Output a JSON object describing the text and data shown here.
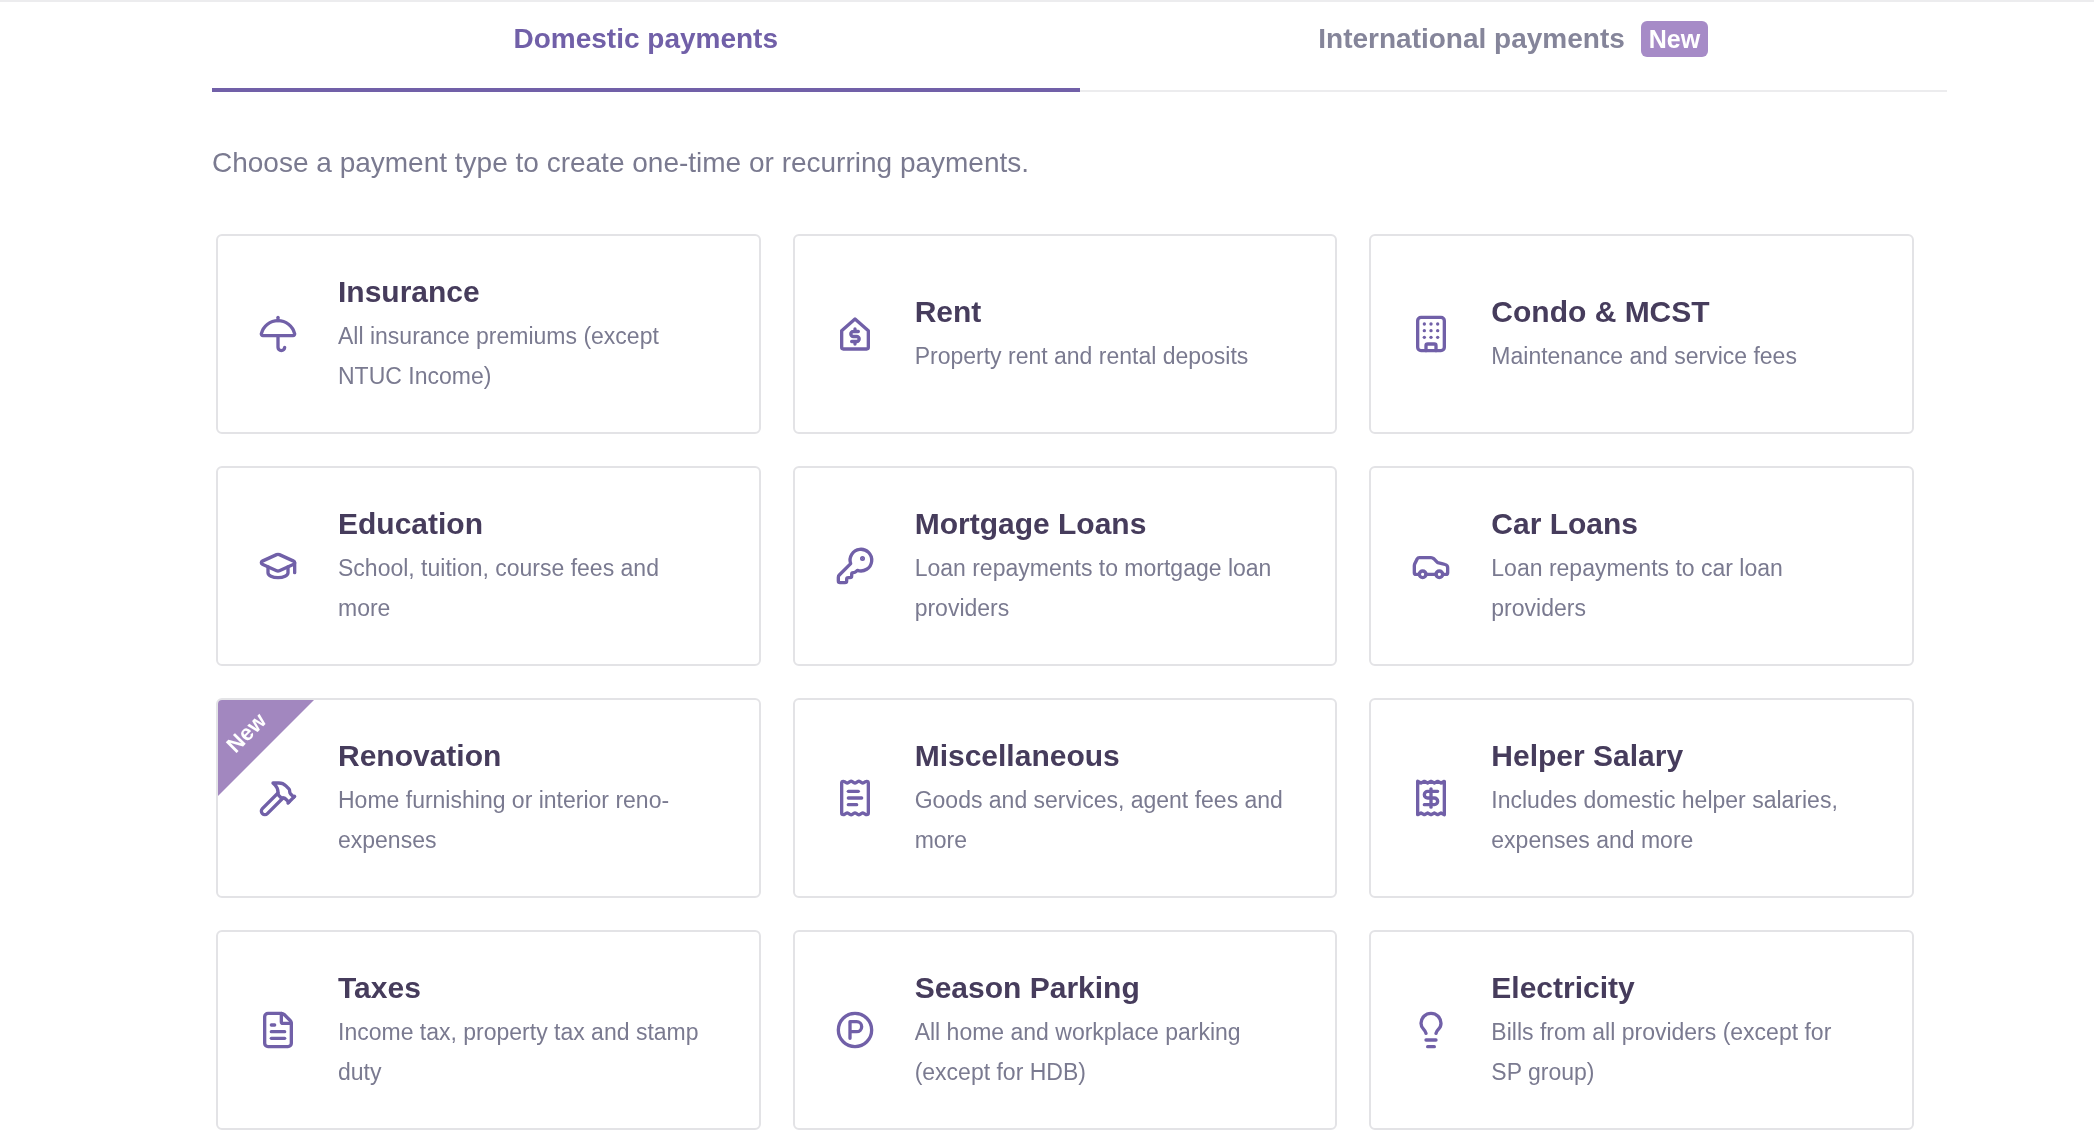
{
  "tabs": [
    {
      "label": "Domestic payments",
      "selected": true
    },
    {
      "label": "International payments",
      "selected": false,
      "badge": "New"
    }
  ],
  "intro": "Choose a payment type to create one-time or recurring payments.",
  "payment_types": [
    {
      "title": "Insurance",
      "description": "All insurance premiums (except NTUC Income)"
    },
    {
      "title": "Rent",
      "description": "Property rent and rental deposits"
    },
    {
      "title": "Condo & MCST",
      "description": "Maintenance and service fees"
    },
    {
      "title": "Education",
      "description": "School, tuition, course fees and more"
    },
    {
      "title": "Mortgage Loans",
      "description": "Loan repayments to mortgage loan providers"
    },
    {
      "title": "Car Loans",
      "description": "Loan repayments to car loan providers"
    },
    {
      "title": "Renovation",
      "description": "Home furnishing or interior reno-expenses",
      "ribbon": "New"
    },
    {
      "title": "Miscellaneous",
      "description": "Goods and services, agent fees and more"
    },
    {
      "title": "Helper Salary",
      "description": "Includes domestic helper salaries, expenses and more"
    },
    {
      "title": "Taxes",
      "description": "Income tax, property tax and stamp duty"
    },
    {
      "title": "Season Parking",
      "description": "All home and workplace parking (except for HDB)"
    },
    {
      "title": "Electricity",
      "description": "Bills from all providers (except for SP group)"
    }
  ]
}
